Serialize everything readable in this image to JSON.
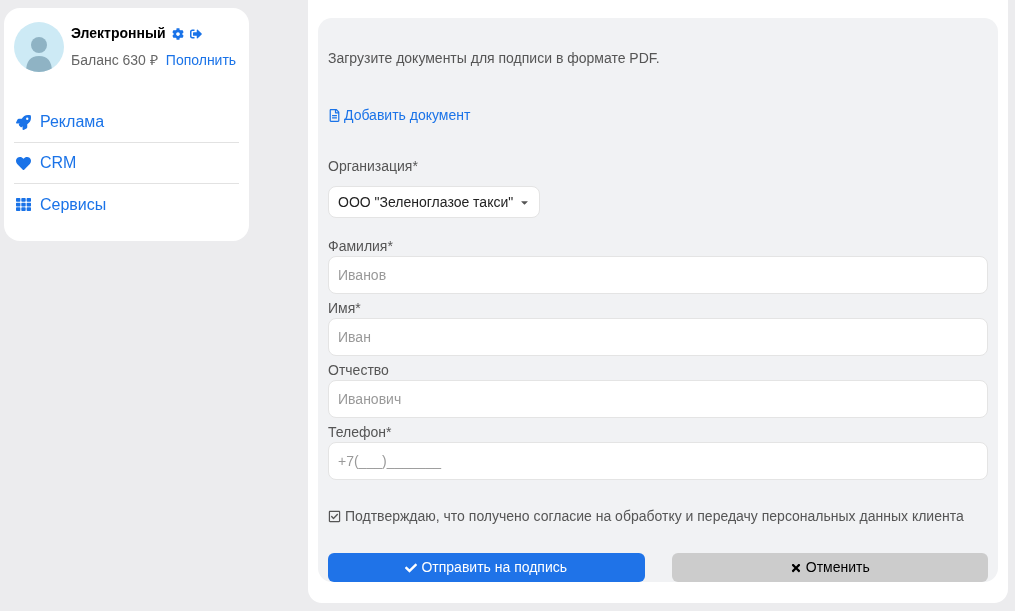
{
  "profile": {
    "name": "Электронный",
    "balance": "Баланс 630",
    "currency": "₽",
    "topup": "Пополнить"
  },
  "nav": [
    {
      "kind": "rocket",
      "label": "Реклама"
    },
    {
      "kind": "heart",
      "label": "CRM"
    },
    {
      "kind": "grid",
      "label": "Сервисы"
    }
  ],
  "form": {
    "intro": "Загрузите документы для подписи в формате PDF.",
    "add_document": "Добавить документ",
    "organization": {
      "label": "Организация*",
      "value": "ООО \"Зеленоглазое такси\""
    },
    "fields": [
      {
        "label": "Фамилия*",
        "placeholder": "Иванов"
      },
      {
        "label": "Имя*",
        "placeholder": "Иван"
      },
      {
        "label": "Отчество",
        "placeholder": "Иванович"
      },
      {
        "label": "Телефон*",
        "placeholder": "+7(___)_______"
      }
    ],
    "consent": {
      "label": "Подтверждаю, что получено согласие на обработку и передачу персональных данных клиента",
      "checked": true
    },
    "buttons": [
      {
        "kind": "submit",
        "label": "Отправить на подпись"
      },
      {
        "kind": "cancel",
        "label": "Отменить"
      }
    ]
  }
}
